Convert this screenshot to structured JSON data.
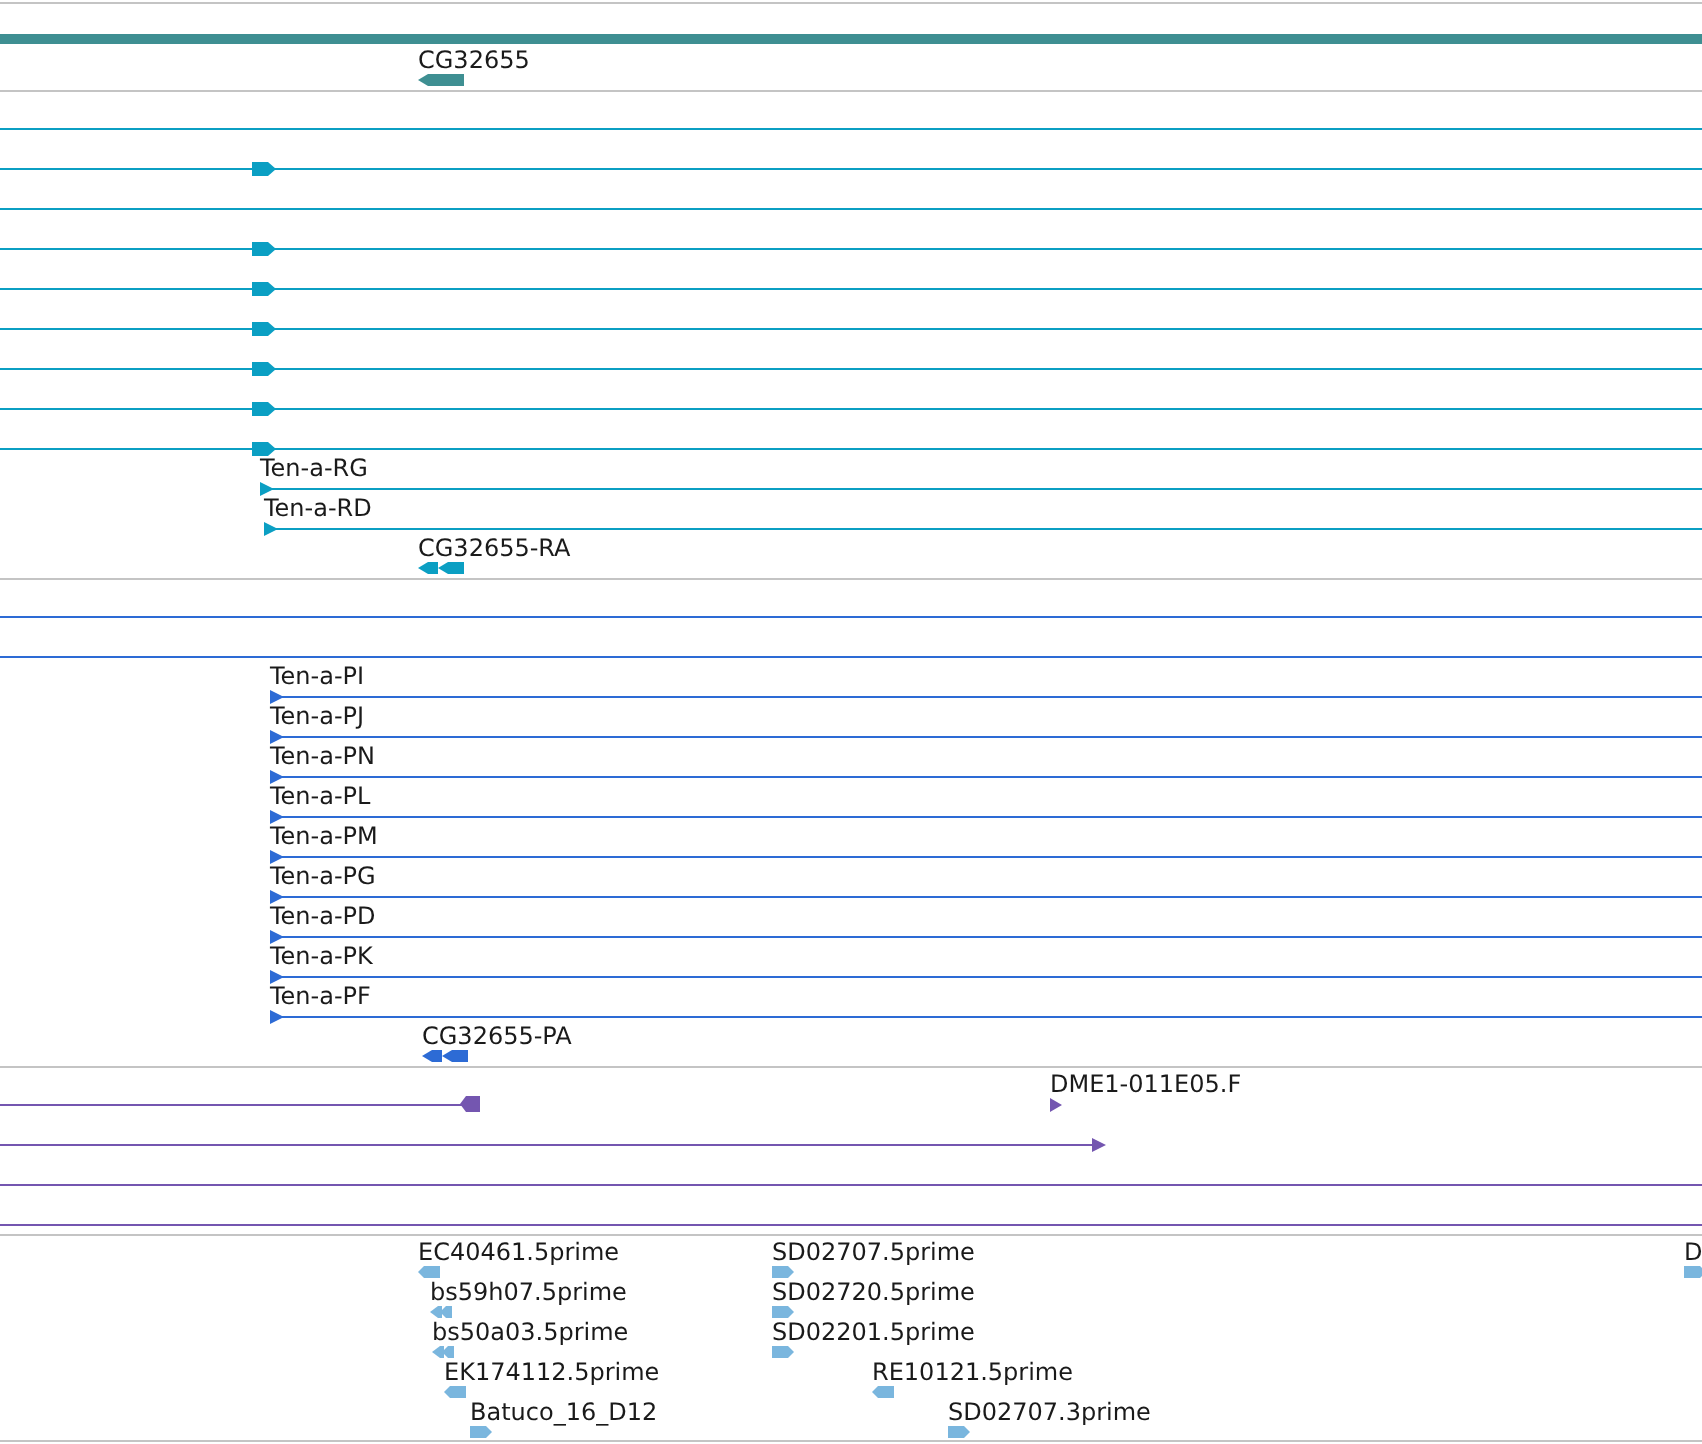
{
  "tracks": [
    {
      "color": "#3e8f92",
      "rows": [
        {
          "features": [
            {
              "kind": "bar"
            }
          ]
        },
        {
          "features": [
            {
              "kind": "block_left",
              "label": "CG32655"
            }
          ]
        }
      ]
    },
    {
      "color": "#0b9fc3",
      "rows": [
        {
          "features": [
            {
              "kind": "line"
            }
          ]
        },
        {
          "features": [
            {
              "kind": "line"
            },
            {
              "kind": "exon_right"
            }
          ]
        },
        {
          "features": [
            {
              "kind": "line"
            }
          ]
        },
        {
          "features": [
            {
              "kind": "line"
            },
            {
              "kind": "exon_right"
            }
          ]
        },
        {
          "features": [
            {
              "kind": "line"
            },
            {
              "kind": "exon_right"
            }
          ]
        },
        {
          "features": [
            {
              "kind": "line"
            },
            {
              "kind": "exon_right"
            }
          ]
        },
        {
          "features": [
            {
              "kind": "line"
            },
            {
              "kind": "exon_right"
            }
          ]
        },
        {
          "features": [
            {
              "kind": "line"
            },
            {
              "kind": "exon_right"
            }
          ]
        },
        {
          "features": [
            {
              "kind": "line"
            },
            {
              "kind": "exon_right"
            }
          ]
        },
        {
          "features": [
            {
              "kind": "start_right",
              "label": "Ten-a-RG"
            }
          ]
        },
        {
          "features": [
            {
              "kind": "start_right",
              "label": "Ten-a-RD"
            }
          ]
        },
        {
          "features": [
            {
              "kind": "double_left",
              "label": "CG32655-RA"
            }
          ]
        }
      ]
    },
    {
      "color": "#2d6bd5",
      "rows": [
        {
          "features": [
            {
              "kind": "line"
            }
          ]
        },
        {
          "features": [
            {
              "kind": "line"
            }
          ]
        },
        {
          "features": [
            {
              "kind": "start_right",
              "label": "Ten-a-PI"
            }
          ]
        },
        {
          "features": [
            {
              "kind": "start_right",
              "label": "Ten-a-PJ"
            }
          ]
        },
        {
          "features": [
            {
              "kind": "start_right",
              "label": "Ten-a-PN"
            }
          ]
        },
        {
          "features": [
            {
              "kind": "start_right",
              "label": "Ten-a-PL"
            }
          ]
        },
        {
          "features": [
            {
              "kind": "start_right",
              "label": "Ten-a-PM"
            }
          ]
        },
        {
          "features": [
            {
              "kind": "start_right",
              "label": "Ten-a-PG"
            }
          ]
        },
        {
          "features": [
            {
              "kind": "start_right",
              "label": "Ten-a-PD"
            }
          ]
        },
        {
          "features": [
            {
              "kind": "start_right",
              "label": "Ten-a-PK"
            }
          ]
        },
        {
          "features": [
            {
              "kind": "start_right",
              "label": "Ten-a-PF"
            }
          ]
        },
        {
          "features": [
            {
              "kind": "double_left",
              "label": "CG32655-PA"
            }
          ]
        }
      ]
    },
    {
      "color": "#7456b0",
      "rows": [
        {
          "features": [
            {
              "kind": "end_block"
            },
            {
              "kind": "mark_right",
              "label": "DME1-011E05.F"
            }
          ]
        },
        {
          "features": [
            {
              "kind": "end_right"
            }
          ]
        },
        {
          "features": [
            {
              "kind": "line"
            }
          ]
        },
        {
          "features": [
            {
              "kind": "line"
            }
          ]
        }
      ]
    },
    {
      "color": "#7ab6de",
      "rows": [
        {
          "features": [
            {
              "kind": "read_left",
              "label": "EC40461.5prime"
            },
            {
              "kind": "read_right",
              "label": "SD02707.5prime"
            },
            {
              "kind": "read_right",
              "label": "D"
            }
          ]
        },
        {
          "features": [
            {
              "kind": "read_double_left",
              "label": "bs59h07.5prime"
            },
            {
              "kind": "read_right",
              "label": "SD02720.5prime"
            }
          ]
        },
        {
          "features": [
            {
              "kind": "read_double_left",
              "label": "bs50a03.5prime"
            },
            {
              "kind": "read_right",
              "label": "SD02201.5prime"
            }
          ]
        },
        {
          "features": [
            {
              "kind": "read_left",
              "label": "EK174112.5prime"
            },
            {
              "kind": "read_left",
              "label": "RE10121.5prime"
            }
          ]
        },
        {
          "features": [
            {
              "kind": "read_right",
              "label": "Batuco_16_D12"
            },
            {
              "kind": "read_right",
              "label": "SD02707.3prime"
            }
          ]
        }
      ]
    }
  ]
}
